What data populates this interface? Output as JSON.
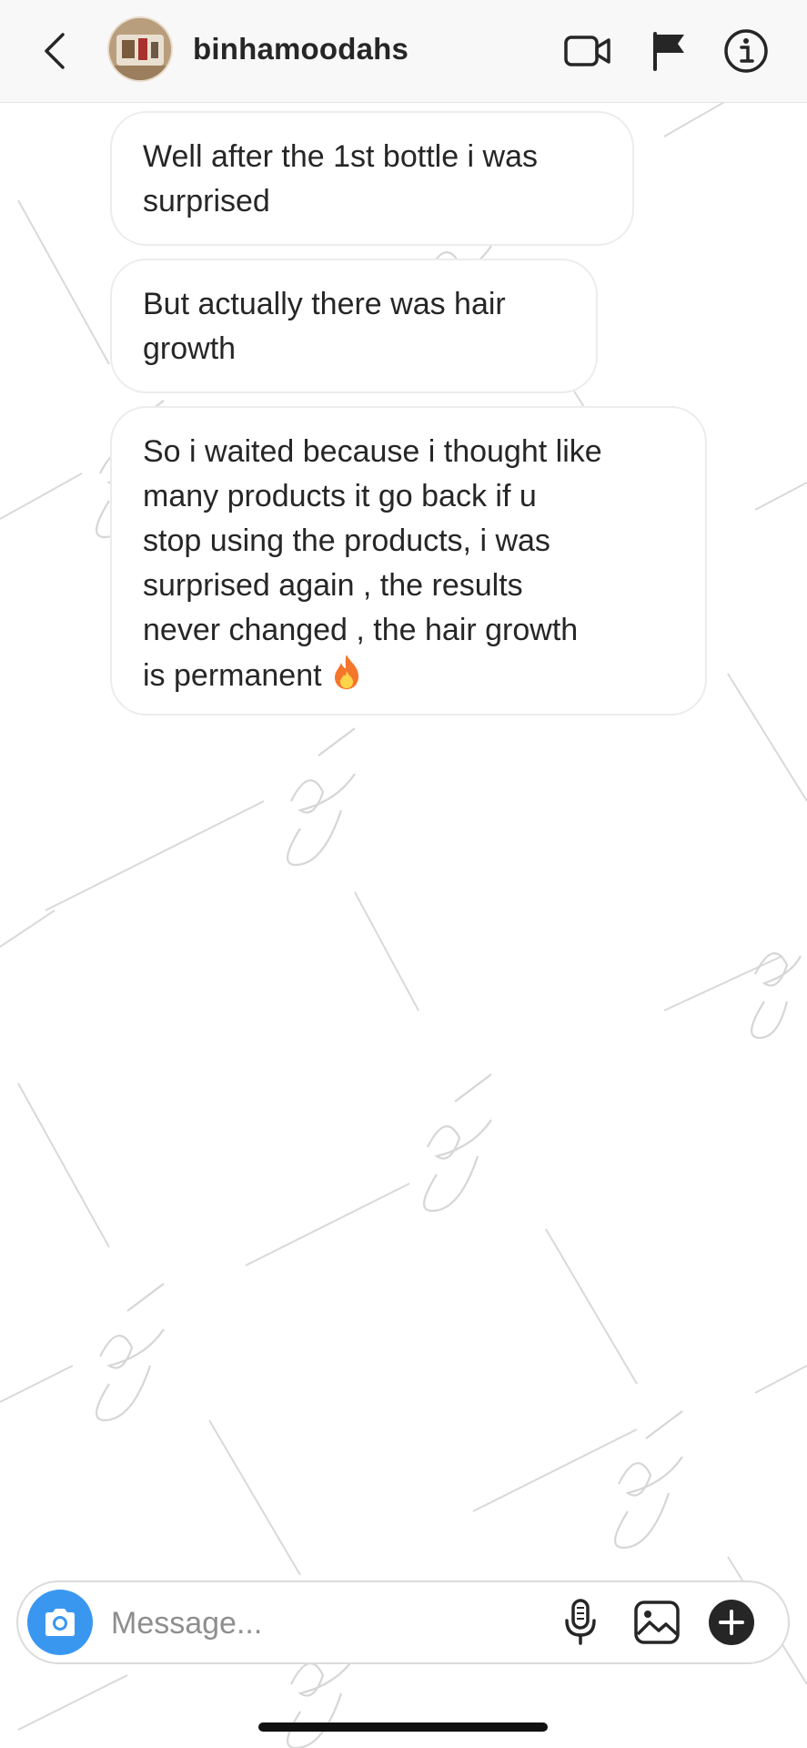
{
  "header": {
    "username": "binhamoodahs",
    "icons": [
      "back-chevron-icon",
      "avatar",
      "video-camera-icon",
      "flag-icon",
      "info-icon"
    ]
  },
  "messages": [
    {
      "lines": [
        "Well after the 1st bottle i was",
        "surprised"
      ]
    },
    {
      "lines": [
        "But actually there was hair",
        "growth"
      ]
    },
    {
      "lines": [
        "So i waited because i thought like",
        "many products it go back if u",
        "stop using the products, i was",
        "surprised again , the results",
        "never changed , the hair growth",
        "is permanent"
      ],
      "trailing_emoji": "fire"
    }
  ],
  "composer": {
    "placeholder": "Message...",
    "icons": [
      "camera-icon",
      "microphone-icon",
      "gallery-icon",
      "plus-icon"
    ]
  },
  "watermark": {
    "text": "Beaulouis",
    "style": "handwritten signature, light gray, repeated"
  },
  "colors": {
    "header_bg": "#f8f8f8",
    "camera_button": "#3a97f0",
    "bubble_border": "#ececec",
    "text": "#262626",
    "placeholder": "#8e8e8e",
    "plus_button": "#262626",
    "fire_outer": "#f4762a",
    "fire_inner": "#fdd44a"
  }
}
